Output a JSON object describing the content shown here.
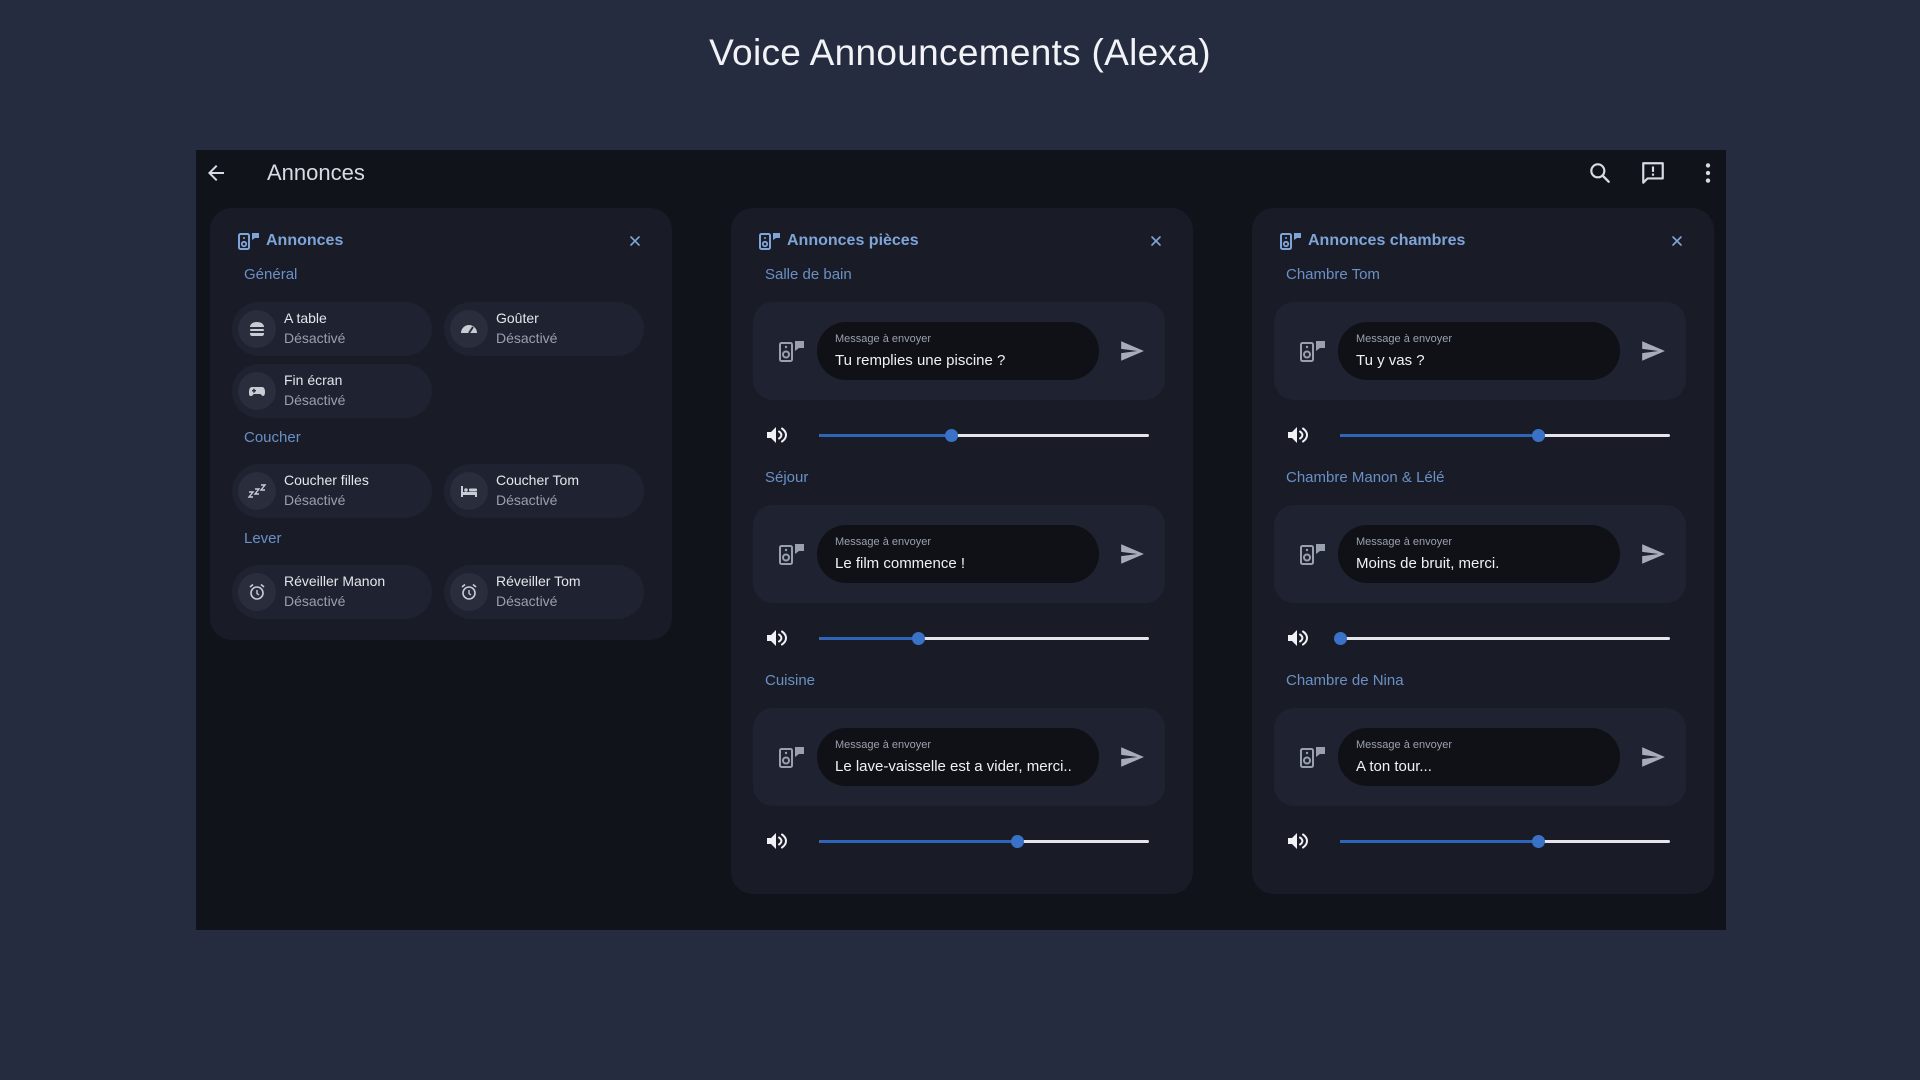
{
  "page_title": "Voice Announcements (Alexa)",
  "topbar": {
    "title": "Annonces"
  },
  "panels": {
    "general": {
      "title": "Annonces",
      "groups": [
        {
          "label": "Général",
          "items": [
            {
              "name": "A table",
              "state": "Désactivé",
              "icon": "burger-icon"
            },
            {
              "name": "Goûter",
              "state": "Désactivé",
              "icon": "speed-gauge-icon"
            },
            {
              "name": "Fin écran",
              "state": "Désactivé",
              "icon": "gamepad-icon"
            }
          ]
        },
        {
          "label": "Coucher",
          "items": [
            {
              "name": "Coucher filles",
              "state": "Désactivé",
              "icon": "sleep-zzz-icon"
            },
            {
              "name": "Coucher Tom",
              "state": "Désactivé",
              "icon": "bed-icon"
            }
          ]
        },
        {
          "label": "Lever",
          "items": [
            {
              "name": "Réveiller Manon",
              "state": "Désactivé",
              "icon": "alarm-clock-icon"
            },
            {
              "name": "Réveiller Tom",
              "state": "Désactivé",
              "icon": "alarm-clock-icon"
            }
          ]
        }
      ]
    },
    "rooms": {
      "title": "Annonces pièces",
      "items": [
        {
          "room": "Salle de bain",
          "message_label": "Message à envoyer",
          "message": "Tu remplies une piscine ?",
          "volume": 0.4
        },
        {
          "room": "Séjour",
          "message_label": "Message à envoyer",
          "message": "Le film commence !",
          "volume": 0.3
        },
        {
          "room": "Cuisine",
          "message_label": "Message à envoyer",
          "message": "Le lave-vaisselle est a vider, merci..",
          "volume": 0.6
        }
      ]
    },
    "bedrooms": {
      "title": "Annonces chambres",
      "items": [
        {
          "room": "Chambre Tom",
          "message_label": "Message à envoyer",
          "message": "Tu y vas ?",
          "volume": 0.6
        },
        {
          "room": "Chambre Manon & Lélé",
          "message_label": "Message à envoyer",
          "message": "Moins de bruit, merci.",
          "volume": 0.0
        },
        {
          "room": "Chambre de Nina",
          "message_label": "Message à envoyer",
          "message": "A ton tour...",
          "volume": 0.6
        }
      ]
    }
  },
  "colors": {
    "accent": "#3a72c8",
    "section_label": "#6a90c6",
    "panel_title": "#7fa4d8",
    "background": "#262c40",
    "app_bg": "#101319"
  }
}
